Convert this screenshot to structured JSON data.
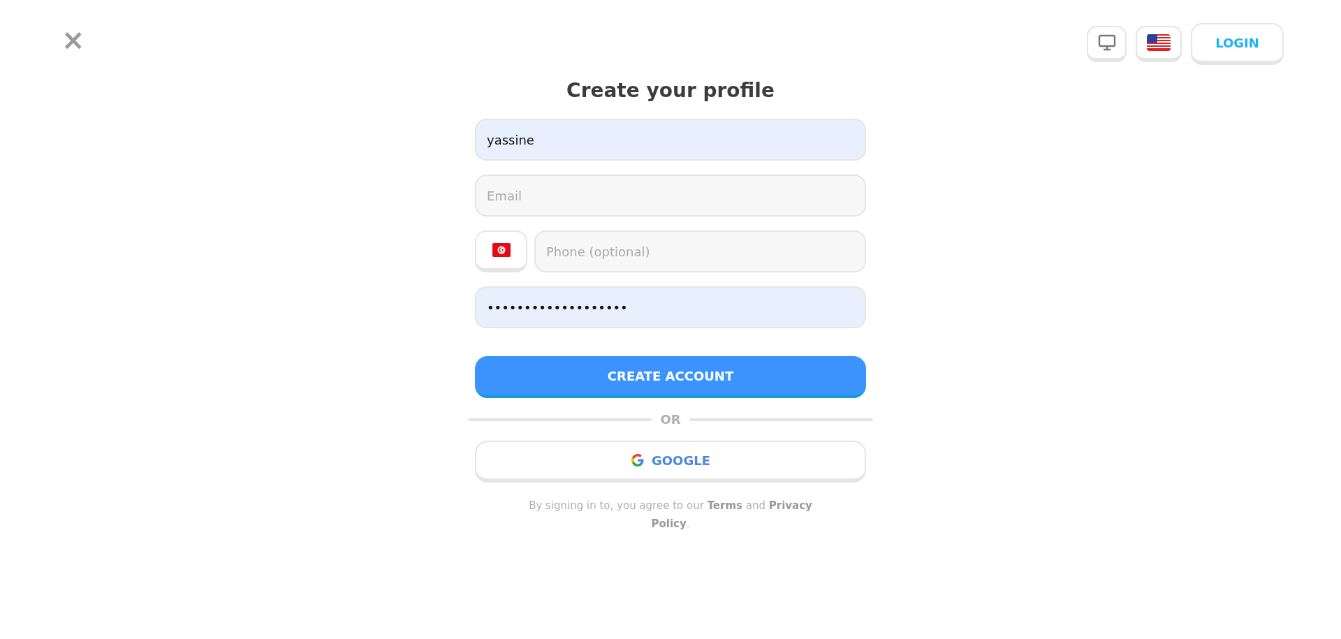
{
  "header": {
    "close": "×",
    "login": "LOGIN"
  },
  "title": "Create your profile",
  "fields": [
    {
      "kind": "text",
      "value": "yassine",
      "autofilled": true
    },
    {
      "kind": "text",
      "placeholder": "Email",
      "autofilled": false
    },
    {
      "kind": "phone",
      "placeholder": "Phone (optional)",
      "autofilled": false
    },
    {
      "kind": "text",
      "value": "•••••••••••••••••••",
      "autofilled": true
    }
  ],
  "submit": "CREATE ACCOUNT",
  "divider": "OR",
  "google": "GOOGLE",
  "legal": "By signing in to, you agree to our **Terms** and **Privacy Policy**."
}
